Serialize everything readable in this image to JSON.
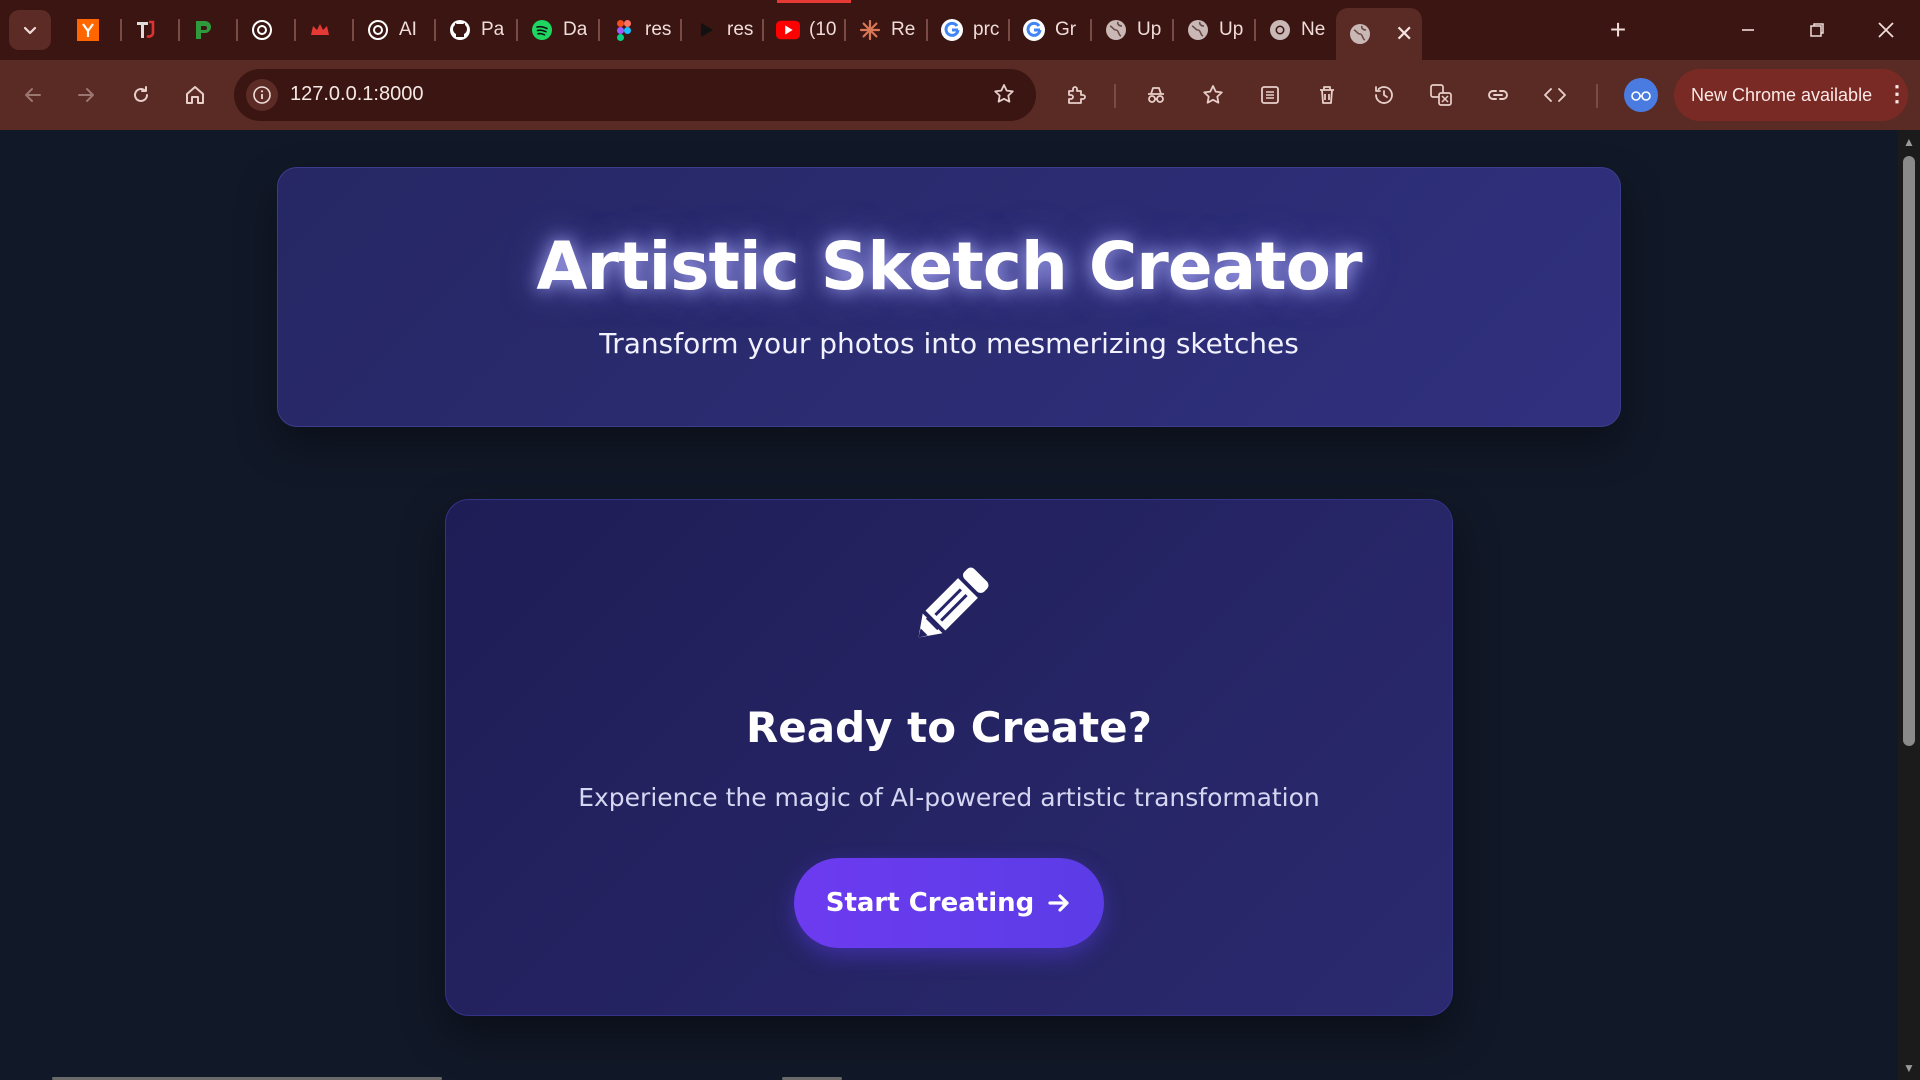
{
  "browser": {
    "tabs": [
      {
        "title": "",
        "icon": "y-combinator-icon",
        "color": "#ff6600"
      },
      {
        "title": "",
        "icon": "tj-icon",
        "color": "#d33"
      },
      {
        "title": "",
        "icon": "green-p-icon",
        "color": "#2e9a3c"
      },
      {
        "title": "",
        "icon": "openai-icon",
        "color": "#ffffff"
      },
      {
        "title": "",
        "icon": "crown-icon",
        "color": "#e53935"
      },
      {
        "title": "AI",
        "icon": "openai-icon",
        "color": "#ffffff"
      },
      {
        "title": "Pa",
        "icon": "github-icon",
        "color": "#ffffff"
      },
      {
        "title": "Da",
        "icon": "spotify-icon",
        "color": "#1ed760"
      },
      {
        "title": "res",
        "icon": "figma-icon",
        "color": "#f24e1e"
      },
      {
        "title": "res",
        "icon": "play-icon",
        "color": "#111111"
      },
      {
        "title": "(10",
        "icon": "youtube-icon",
        "color": "#ff0000"
      },
      {
        "title": "Re",
        "icon": "claude-icon",
        "color": "#d97757"
      },
      {
        "title": "prc",
        "icon": "google-icon",
        "color": "#4285f4"
      },
      {
        "title": "Gr",
        "icon": "google-icon",
        "color": "#4285f4"
      },
      {
        "title": "Up",
        "icon": "globe-icon",
        "color": "#c9b8b5"
      },
      {
        "title": "Up",
        "icon": "globe-icon",
        "color": "#c9b8b5"
      },
      {
        "title": "Ne",
        "icon": "chrome-icon",
        "color": "#c9b8b5"
      },
      {
        "title": "",
        "icon": "globe-icon",
        "color": "#c9b8b5",
        "active": true
      }
    ],
    "address": "127.0.0.1:8000",
    "update_label": "New Chrome available",
    "accent_color": "#5a2a25"
  },
  "hero": {
    "title": "Artistic Sketch Creator",
    "subtitle": "Transform your photos into mesmerizing sketches"
  },
  "card": {
    "icon": "pencil-icon",
    "title": "Ready to Create?",
    "description": "Experience the magic of AI-powered artistic transformation",
    "cta_label": "Start Creating",
    "cta_color": "#6d3bf0"
  }
}
